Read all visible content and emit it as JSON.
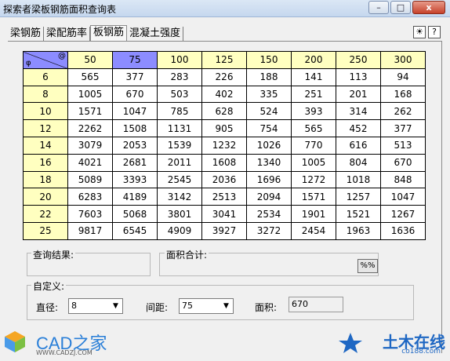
{
  "window": {
    "title": "探索者梁板钢筋面积查询表",
    "buttons": [
      "–",
      "□",
      "x"
    ]
  },
  "tabs": [
    "梁钢筋",
    "梁配筋率",
    "板钢筋",
    "混凝土强度"
  ],
  "active_tab": 2,
  "corner_icons": [
    "bulb-icon",
    "help-icon"
  ],
  "table": {
    "corner_row_label": "φ",
    "corner_col_label": "@",
    "spacings": [
      "50",
      "75",
      "100",
      "125",
      "150",
      "200",
      "250",
      "300"
    ],
    "selected_spacing": "75",
    "rows": [
      {
        "dia": "6",
        "values": [
          "565",
          "377",
          "283",
          "226",
          "188",
          "141",
          "113",
          "94"
        ]
      },
      {
        "dia": "8",
        "values": [
          "1005",
          "670",
          "503",
          "402",
          "335",
          "251",
          "201",
          "168"
        ]
      },
      {
        "dia": "10",
        "values": [
          "1571",
          "1047",
          "785",
          "628",
          "524",
          "393",
          "314",
          "262"
        ]
      },
      {
        "dia": "12",
        "values": [
          "2262",
          "1508",
          "1131",
          "905",
          "754",
          "565",
          "452",
          "377"
        ]
      },
      {
        "dia": "14",
        "values": [
          "3079",
          "2053",
          "1539",
          "1232",
          "1026",
          "770",
          "616",
          "513"
        ]
      },
      {
        "dia": "16",
        "values": [
          "4021",
          "2681",
          "2011",
          "1608",
          "1340",
          "1005",
          "804",
          "670"
        ]
      },
      {
        "dia": "18",
        "values": [
          "5089",
          "3393",
          "2545",
          "2036",
          "1696",
          "1272",
          "1018",
          "848"
        ]
      },
      {
        "dia": "20",
        "values": [
          "6283",
          "4189",
          "3142",
          "2513",
          "2094",
          "1571",
          "1257",
          "1047"
        ]
      },
      {
        "dia": "22",
        "values": [
          "7603",
          "5068",
          "3801",
          "3041",
          "2534",
          "1901",
          "1521",
          "1267"
        ]
      },
      {
        "dia": "25",
        "values": [
          "9817",
          "6545",
          "4909",
          "3927",
          "3272",
          "2454",
          "1963",
          "1636"
        ]
      }
    ]
  },
  "results": {
    "query_label": "查询结果:",
    "area_sum_label": "面积合计:",
    "pct_button": "%%"
  },
  "custom": {
    "group_label": "自定义:",
    "diameter_label": "直径:",
    "diameter_value": "8",
    "spacing_label": "间距:",
    "spacing_value": "75",
    "area_label": "面积:",
    "area_value": "670"
  },
  "watermarks": {
    "left_name": "CAD之家",
    "left_url": "WWW.CADZJ.COM",
    "right_name": "土木在线",
    "right_sub": "co188.com"
  },
  "colors": {
    "header_bg": "#ffffc0",
    "selected_bg": "#8c8cff"
  }
}
